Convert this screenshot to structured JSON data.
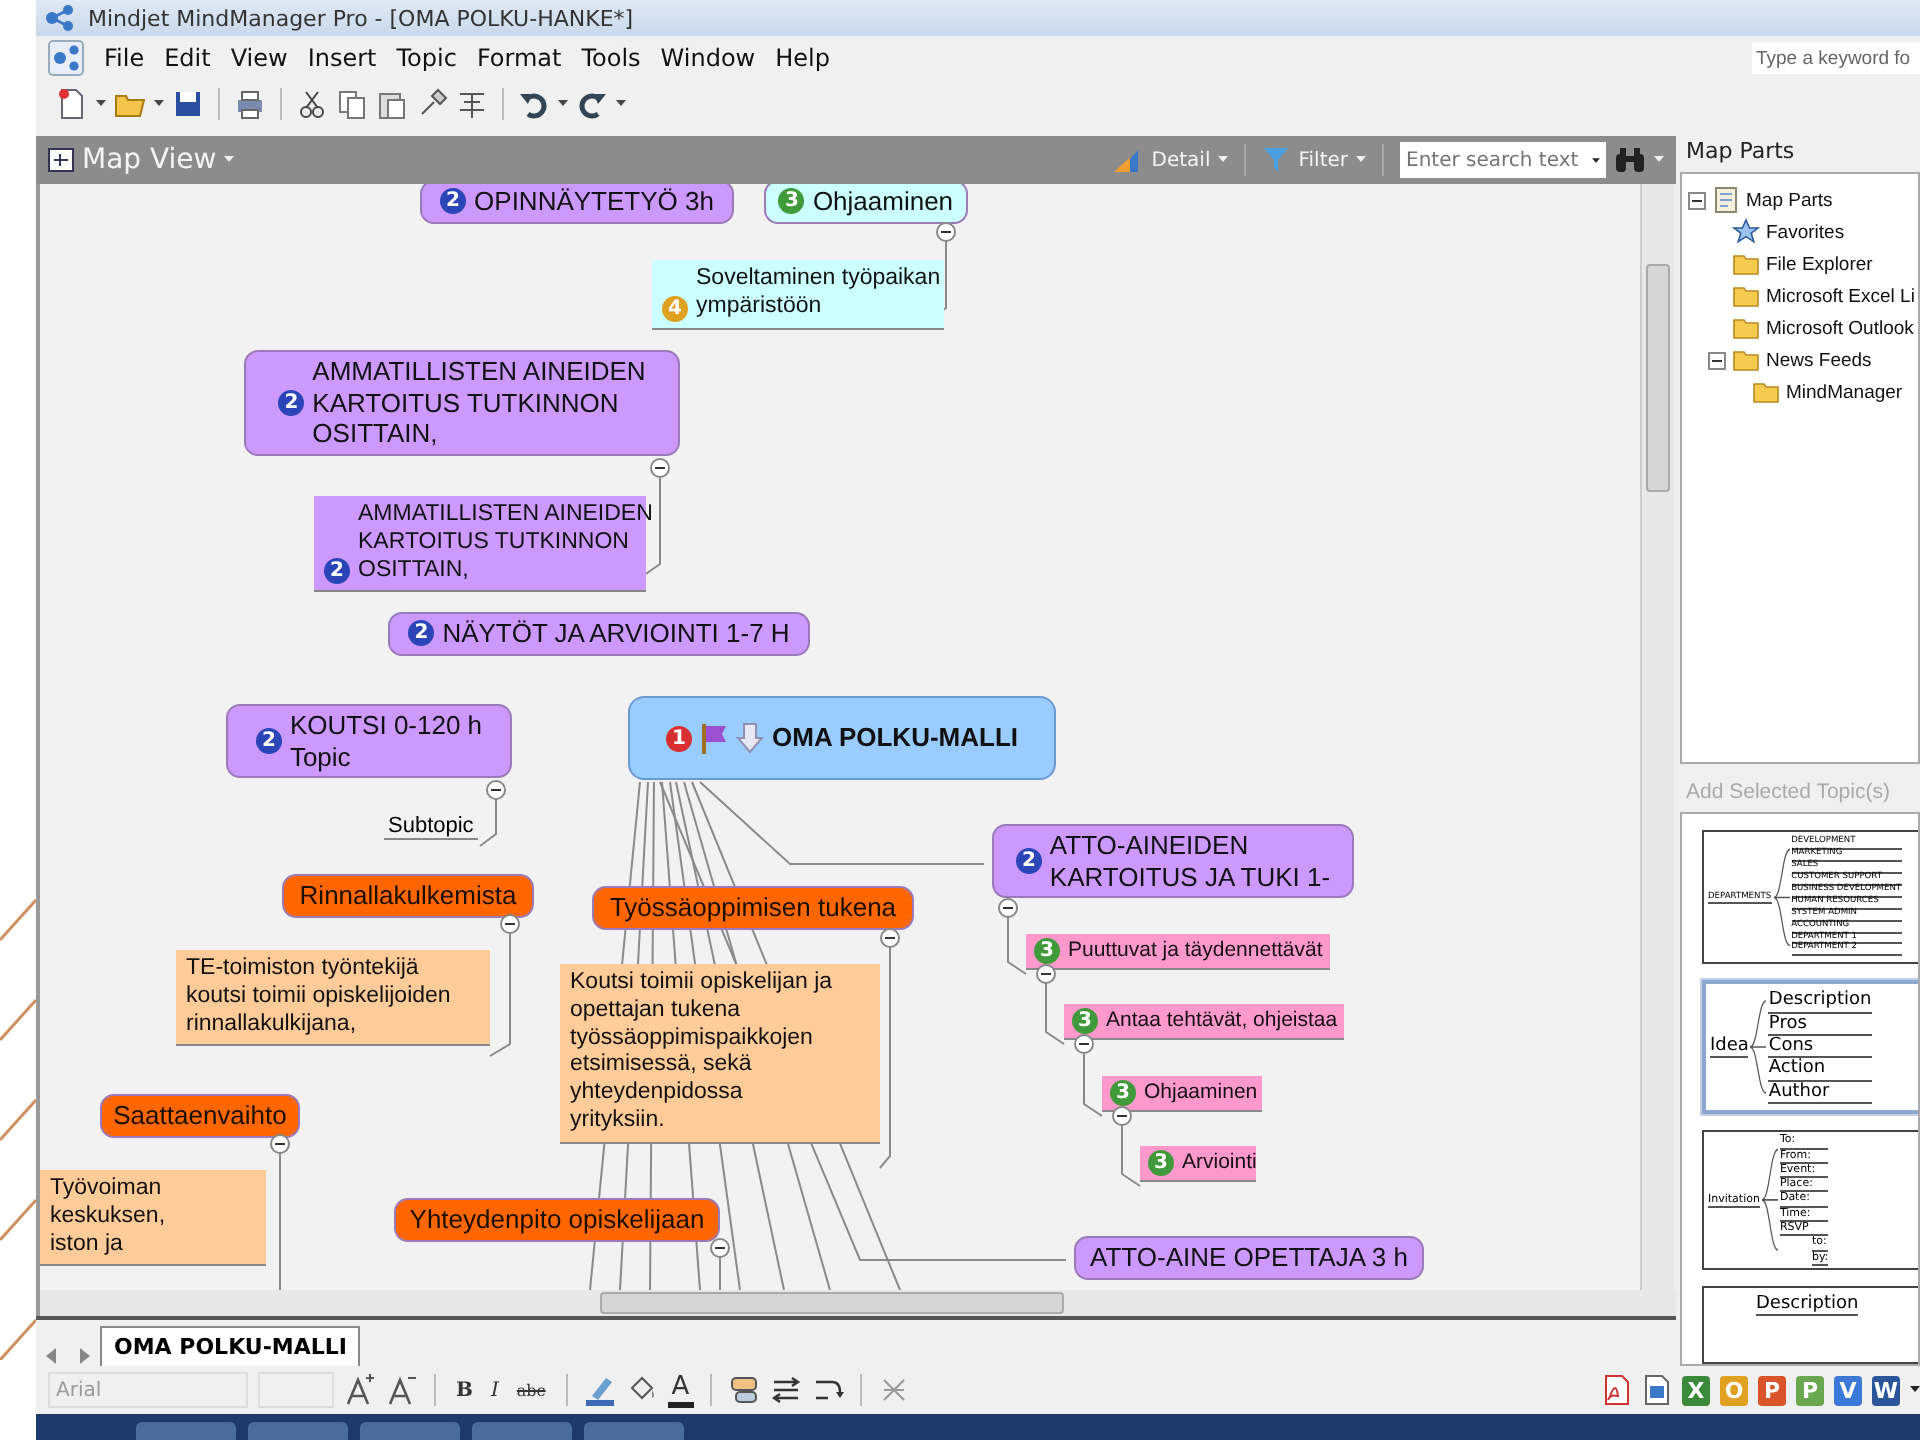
{
  "window": {
    "title": "Mindjet MindManager Pro - [OMA POLKU-HANKE*]"
  },
  "menu": [
    "File",
    "Edit",
    "View",
    "Insert",
    "Topic",
    "Format",
    "Tools",
    "Window",
    "Help"
  ],
  "help_search": {
    "placeholder": "Type a keyword fo"
  },
  "map_view": {
    "title": "Map View",
    "detail": "Detail",
    "filter": "Filter",
    "search": {
      "placeholder": "Enter search text"
    }
  },
  "topics": [
    {
      "kind": "topic",
      "text": "OPINNÄYTETYÖ 3h",
      "priority": "2",
      "color": "#cc99ff"
    },
    {
      "kind": "topic",
      "text": "Ohjaaminen",
      "priority": "3",
      "color": "#ccffff"
    },
    {
      "kind": "note",
      "text": "Soveltaminen työpaikan\nympäristöön",
      "priority": "4",
      "color": "#ccffff"
    },
    {
      "kind": "topic",
      "text": "AMMATILLISTEN AINEIDEN\nKARTOITUS TUTKINNON\nOSITTAIN,",
      "priority": "2",
      "color": "#cc99ff"
    },
    {
      "kind": "note",
      "text": "AMMATILLISTEN AINEIDEN\nKARTOITUS TUTKINNON\nOSITTAIN,",
      "priority": "2",
      "color": "#cc99ff"
    },
    {
      "kind": "topic",
      "text": "NÄYTÖT JA ARVIOINTI 1-7 H",
      "priority": "2",
      "color": "#cc99ff"
    },
    {
      "kind": "topic",
      "text": "KOUTSI 0-120 h\nTopic",
      "priority": "2",
      "color": "#cc99ff"
    },
    {
      "kind": "plain",
      "text": "Subtopic"
    },
    {
      "kind": "central",
      "text": "OMA POLKU-MALLI",
      "priority": "1",
      "color": "#99ccff"
    },
    {
      "kind": "topic",
      "text": "ATTO-AINEIDEN\nKARTOITUS JA TUKI 1-",
      "priority": "2",
      "color": "#cc99ff"
    },
    {
      "kind": "subtopic",
      "text": "Puuttuvat ja täydennettävät",
      "priority": "3",
      "color": "#ff99cc"
    },
    {
      "kind": "subtopic",
      "text": "Antaa tehtävät, ohjeistaa",
      "priority": "3",
      "color": "#ff99cc"
    },
    {
      "kind": "subtopic",
      "text": "Ohjaaminen",
      "priority": "3",
      "color": "#ff99cc"
    },
    {
      "kind": "subtopic",
      "text": "Arviointi",
      "priority": "3",
      "color": "#ff99cc"
    },
    {
      "kind": "topic",
      "text": "ATTO-AINE OPETTAJA 3 h",
      "color": "#cc99ff"
    },
    {
      "kind": "topic",
      "text": "Rinnallakulkemista",
      "color": "#ff6600"
    },
    {
      "kind": "note",
      "text": "TE-toimiston työntekijä\nkoutsi toimii opiskelijoiden\nrinnallakulkijana,",
      "color": "#ffcc99"
    },
    {
      "kind": "topic",
      "text": "Saattaenvaihto",
      "color": "#ff6600"
    },
    {
      "kind": "note",
      "text": "Työvoiman\nkeskuksen,\niston ja",
      "color": "#ffcc99"
    },
    {
      "kind": "topic",
      "text": "Työssäoppimisen tukena",
      "color": "#ff6600"
    },
    {
      "kind": "note",
      "text": "Koutsi toimii opiskelijan ja\nopettajan tukena\ntyössäoppimispaikkojen\netsimisessä, sekä\nyhteydenpidossa\nyrityksiin.",
      "color": "#ffcc99"
    },
    {
      "kind": "topic",
      "text": "Yhteydenpito opiskelijaan",
      "color": "#ff6600"
    }
  ],
  "map_parts": {
    "title": "Map Parts",
    "tree": [
      {
        "label": "Map Parts",
        "expanded": true,
        "children": [
          {
            "label": "Favorites"
          },
          {
            "label": "File Explorer"
          },
          {
            "label": "Microsoft Excel Li"
          },
          {
            "label": "Microsoft Outlook"
          },
          {
            "label": "News Feeds",
            "expanded": true,
            "children": [
              {
                "label": "MindManager"
              }
            ]
          }
        ]
      }
    ]
  },
  "add_topics": {
    "label": "Add Selected Topic(s)",
    "disabled": true
  },
  "templates": [
    {
      "kind": "dense",
      "selected": false,
      "root": "DEPARTMENTS",
      "branches": [
        "DEVELOPMENT",
        "MARKETING",
        "SALES",
        "CUSTOMER SUPPORT",
        "BUSINESS DEVELOPMENT",
        "HUMAN RESOURCES",
        "SYSTEM ADMIN",
        "ACCOUNTING",
        "DEPARTMENT 1",
        "DEPARTMENT 2"
      ]
    },
    {
      "kind": "regular",
      "selected": true,
      "root": "Idea",
      "branches": [
        "Description",
        "Pros",
        "Cons",
        "Action",
        "Author"
      ]
    },
    {
      "kind": "small",
      "selected": false,
      "root": "Invitation",
      "branches": [
        "To:",
        "From:",
        "Event:",
        "Place:",
        "Date:",
        "Time:",
        "RSVP"
      ],
      "extra": [
        "to:",
        "by:"
      ]
    },
    {
      "kind": "title",
      "selected": false,
      "root": "Description"
    }
  ],
  "sheet_tabs": [
    {
      "label": "OMA POLKU-MALLI",
      "selected": true
    }
  ],
  "format_bar": {
    "font": "Arial",
    "bold": "B",
    "italic": "I",
    "strike": "abc",
    "font_color": "A"
  },
  "apps": [
    {
      "letter": "X",
      "color": "#3a8a3a"
    },
    {
      "letter": "O",
      "color": "#e0a020"
    },
    {
      "letter": "P",
      "color": "#d9542b"
    },
    {
      "letter": "P",
      "color": "#6aa84f"
    },
    {
      "letter": "V",
      "color": "#3c78d8"
    },
    {
      "letter": "W",
      "color": "#2a5699"
    }
  ]
}
